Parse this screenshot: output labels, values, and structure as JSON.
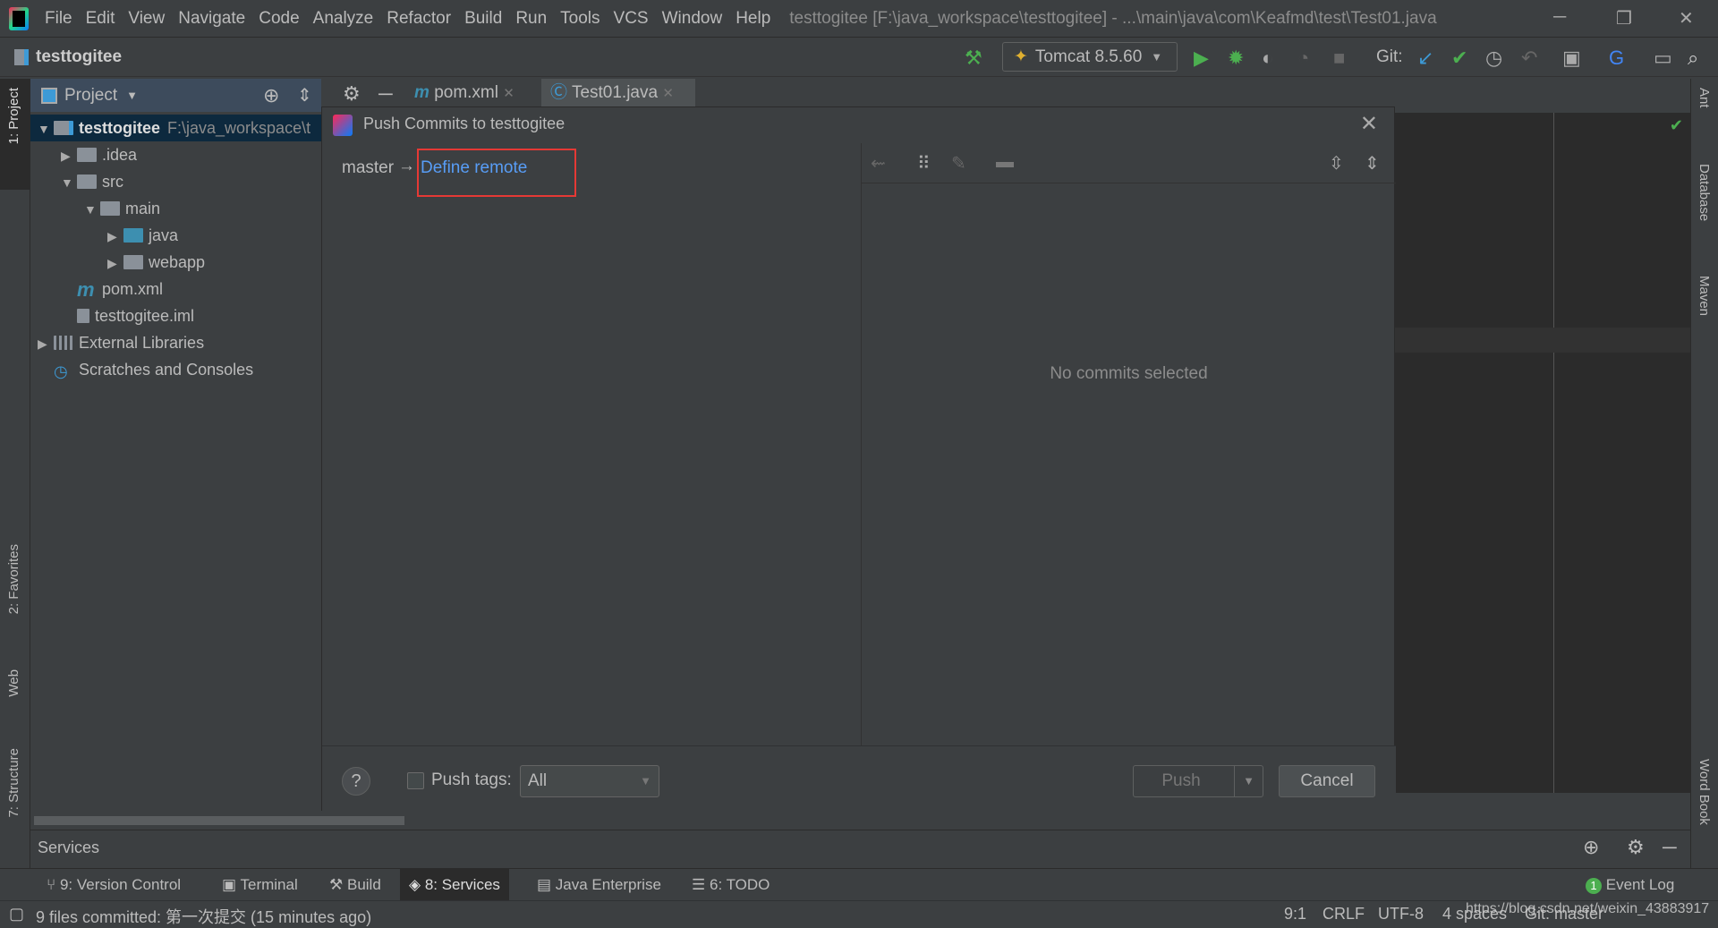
{
  "menu": [
    "File",
    "Edit",
    "View",
    "Navigate",
    "Code",
    "Analyze",
    "Refactor",
    "Build",
    "Run",
    "Tools",
    "VCS",
    "Window",
    "Help"
  ],
  "window_title": "testtogitee [F:\\java_workspace\\testtogitee] - ...\\main\\java\\com\\Keafmd\\test\\Test01.java",
  "toolbar": {
    "project": "testtogitee",
    "run_config": "Tomcat 8.5.60",
    "git_label": "Git:"
  },
  "left_tabs": [
    "1: Project",
    "2: Favorites",
    "Web",
    "7: Structure"
  ],
  "right_tabs": [
    "Ant",
    "Database",
    "Maven",
    "Word Book"
  ],
  "project_panel": {
    "title": "Project"
  },
  "tree": [
    {
      "label": "testtogitee",
      "extra": "F:\\java_workspace\\t",
      "depth": 0,
      "arrow": "down",
      "bold": true
    },
    {
      "label": ".idea",
      "depth": 1,
      "arrow": "right"
    },
    {
      "label": "src",
      "depth": 1,
      "arrow": "down"
    },
    {
      "label": "main",
      "depth": 2,
      "arrow": "down"
    },
    {
      "label": "java",
      "depth": 3,
      "arrow": "right"
    },
    {
      "label": "webapp",
      "depth": 3,
      "arrow": "right"
    },
    {
      "label": "pom.xml",
      "depth": 1,
      "arrow": ""
    },
    {
      "label": "testtogitee.iml",
      "depth": 1,
      "arrow": ""
    },
    {
      "label": "External Libraries",
      "depth": 0,
      "arrow": "right"
    },
    {
      "label": "Scratches and Consoles",
      "depth": 0,
      "arrow": ""
    }
  ],
  "editor_tabs": [
    {
      "label": "pom.xml"
    },
    {
      "label": "Test01.java",
      "active": true
    }
  ],
  "dialog": {
    "title": "Push Commits to testtogitee",
    "branch": "master",
    "arrow": "→",
    "define_remote": "Define remote",
    "no_commits": "No commits selected",
    "push_tags_label": "Push tags:",
    "push_tags_checked": false,
    "tags_value": "All",
    "push": "Push",
    "cancel": "Cancel",
    "help": "?"
  },
  "services": {
    "title": "Services"
  },
  "tool_tabs": [
    "9: Version Control",
    "Terminal",
    "Build",
    "8: Services",
    "Java Enterprise",
    "6: TODO"
  ],
  "event_log": {
    "label": "Event Log",
    "count": "1"
  },
  "status": {
    "message": "9 files committed: 第一次提交 (15 minutes ago)",
    "position": "9:1",
    "line_sep": "CRLF",
    "encoding": "UTF-8",
    "indent": "4 spaces",
    "branch": "Git: master",
    "watermark": "https://blog.csdn.net/weixin_43883917"
  },
  "colors": {
    "link": "#589df6",
    "highlight_box": "#e53935",
    "selection": "#0d293e"
  }
}
